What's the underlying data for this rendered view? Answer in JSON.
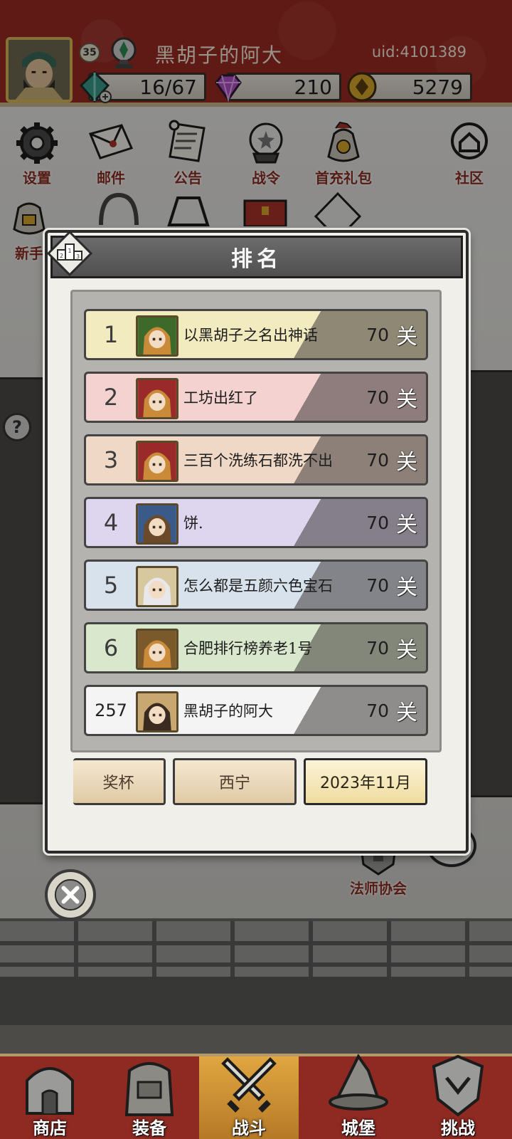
{
  "player": {
    "level": "35",
    "name": "黑胡子的阿大",
    "uid": "uid:4101389"
  },
  "resources": {
    "stamina": "16/67",
    "gems": "210",
    "coins": "5279"
  },
  "menu": {
    "row1": [
      "设置",
      "邮件",
      "公告",
      "战令",
      "首充礼包",
      "社区"
    ],
    "row2_partial": "新手"
  },
  "scene": {
    "guild_label": "法师协会"
  },
  "modal": {
    "title": "排名",
    "rows": [
      {
        "rank": "1",
        "name": "以黑胡子之名出神话",
        "score": "70",
        "unit": "关",
        "color": "#f2ebbf"
      },
      {
        "rank": "2",
        "name": "工坊出红了",
        "score": "70",
        "unit": "关",
        "color": "#f3d2cf"
      },
      {
        "rank": "3",
        "name": "三百个洗练石都洗不出",
        "score": "70",
        "unit": "关",
        "color": "#efd9c6"
      },
      {
        "rank": "4",
        "name": "饼.",
        "score": "70",
        "unit": "关",
        "color": "#ddd6ee"
      },
      {
        "rank": "5",
        "name": "怎么都是五颜六色宝石",
        "score": "70",
        "unit": "关",
        "color": "#d7e2ec"
      },
      {
        "rank": "6",
        "name": "合肥排行榜养老1号",
        "score": "70",
        "unit": "关",
        "color": "#d9e8cc"
      },
      {
        "rank": "257",
        "name": "黑胡子的阿大",
        "score": "70",
        "unit": "关",
        "color": "#f4f4f4"
      }
    ],
    "tabs": [
      "奖杯",
      "西宁",
      "2023年11月"
    ],
    "active_tab": "2023年11月"
  },
  "bottom_nav": [
    "商店",
    "装备",
    "战斗",
    "城堡",
    "挑战"
  ],
  "active_nav": "战斗",
  "colors": {
    "header_red": "#9b2a22",
    "modal_header": "#5c5c5c",
    "nav_active": "#d49a3a"
  }
}
